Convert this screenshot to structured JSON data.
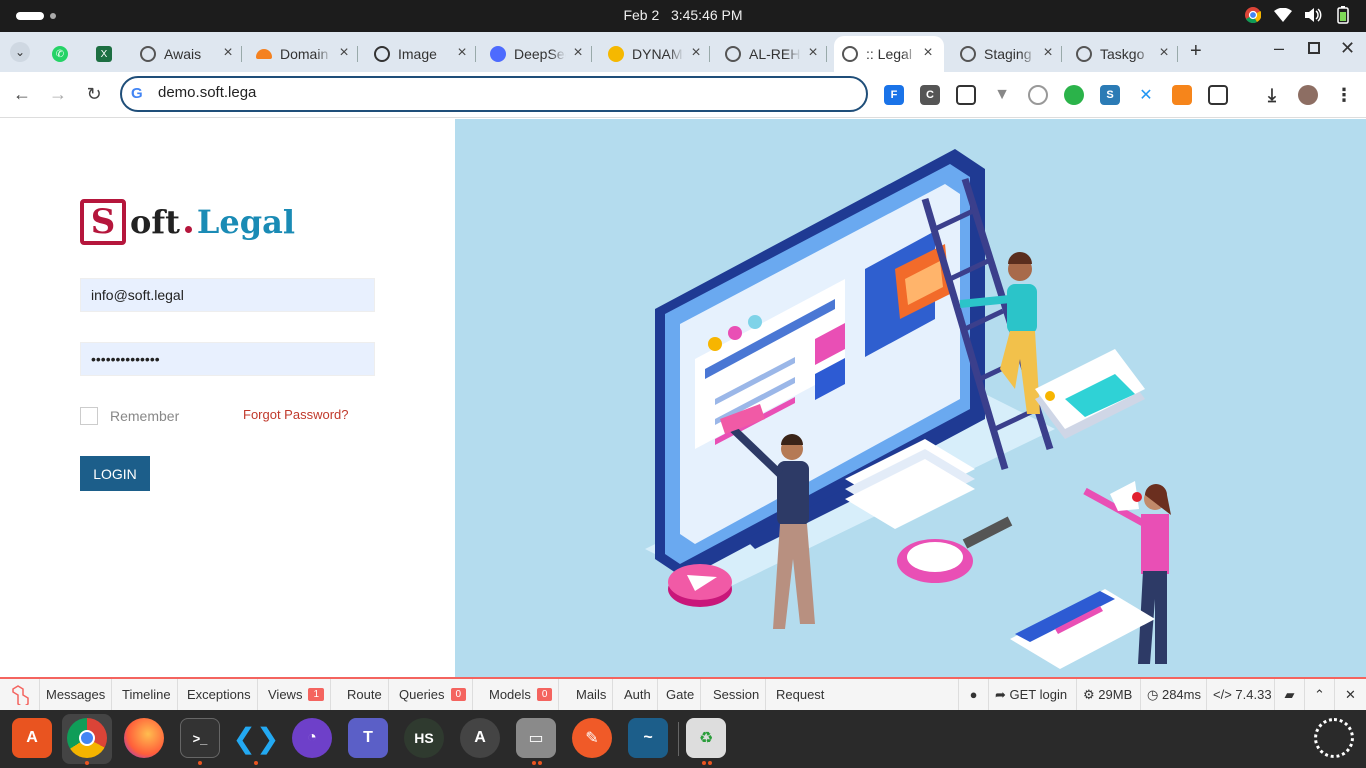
{
  "system": {
    "date": "Feb 2",
    "time": "3:45:46 PM"
  },
  "tabs": [
    {
      "title": "",
      "icon": "whatsapp-icon",
      "color": "#25d366"
    },
    {
      "title": "",
      "icon": "excel-icon",
      "color": "#1d6f42"
    },
    {
      "title": "Awais",
      "icon": "globe-icon",
      "color": "#666"
    },
    {
      "title": "Domain",
      "icon": "cloudflare-icon",
      "color": "#f48120"
    },
    {
      "title": "Image",
      "icon": "openai-icon",
      "color": "#333"
    },
    {
      "title": "DeepSeek",
      "icon": "deepseek-icon",
      "color": "#4d6bfe"
    },
    {
      "title": "DYNAMIC",
      "icon": "sun-icon",
      "color": "#f5b800"
    },
    {
      "title": "AL-REH",
      "icon": "globe-icon",
      "color": "#666"
    },
    {
      "title": ":: Legal",
      "icon": "globe-icon",
      "color": "#666"
    },
    {
      "title": "Staging",
      "icon": "globe-icon",
      "color": "#666"
    },
    {
      "title": "Taskgo",
      "icon": "globe-icon",
      "color": "#666"
    }
  ],
  "address": {
    "url": "demo.soft.lega"
  },
  "logo": {
    "mark": "S",
    "part1": "oft",
    "part2": "Legal"
  },
  "form": {
    "email": "info@soft.legal",
    "password": "••••••••••••••",
    "remember_label": "Remember",
    "forgot_label": "Forgot Password?",
    "login_label": "LOGIN"
  },
  "debugbar": {
    "tabs": [
      {
        "label": "Messages",
        "badge": ""
      },
      {
        "label": "Timeline",
        "badge": ""
      },
      {
        "label": "Exceptions",
        "badge": ""
      },
      {
        "label": "Views",
        "badge": "1"
      },
      {
        "label": "Route",
        "badge": ""
      },
      {
        "label": "Queries",
        "badge": "0"
      },
      {
        "label": "Models",
        "badge": "0"
      },
      {
        "label": "Mails",
        "badge": ""
      },
      {
        "label": "Auth",
        "badge": ""
      },
      {
        "label": "Gate",
        "badge": ""
      },
      {
        "label": "Session",
        "badge": ""
      },
      {
        "label": "Request",
        "badge": ""
      }
    ],
    "method": "GET login",
    "memory": "29MB",
    "duration": "284ms",
    "php_version": "7.4.33"
  },
  "colors": {
    "accent": "#1c5e8a",
    "brand": "#b5163c",
    "debug": "#f4645f",
    "hero_bg": "#b4dcee"
  }
}
